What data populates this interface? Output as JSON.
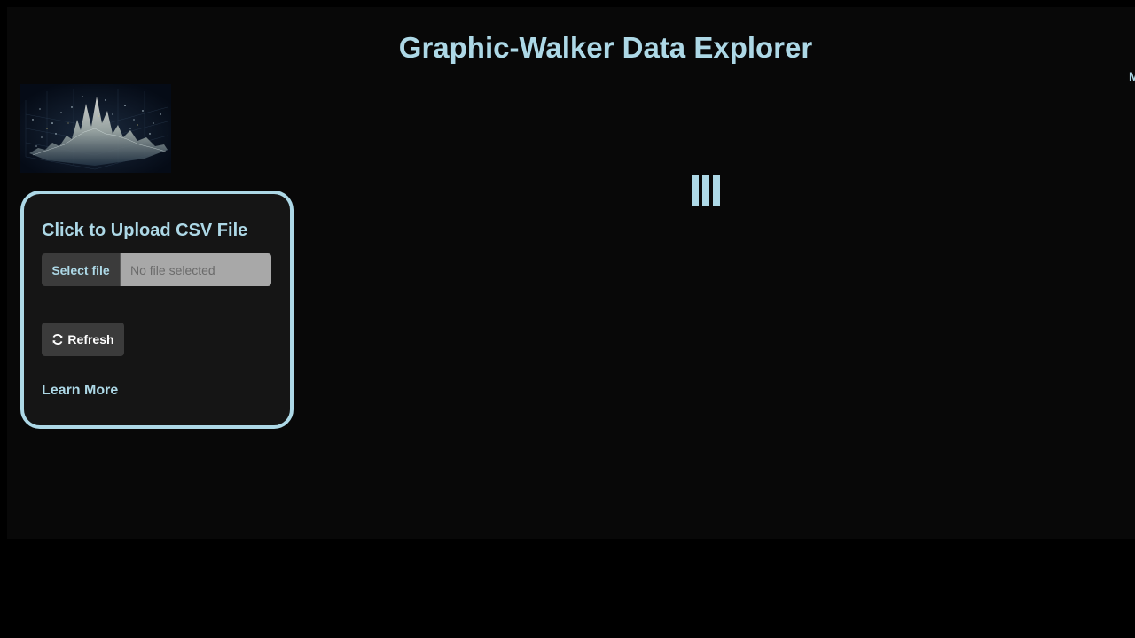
{
  "app": {
    "title": "Graphic-Walker Data Explorer",
    "edge_text": "M"
  },
  "sidebar": {
    "logo": {
      "icon": "data-landscape-image"
    },
    "upload": {
      "heading": "Click to Upload CSV File",
      "select_button_label": "Select file",
      "file_status": "No file selected"
    },
    "refresh_button": {
      "icon": "refresh-icon",
      "label": "Refresh"
    },
    "learn_more_link": "Learn More"
  },
  "main": {
    "loading_indicator": {
      "icon": "loading-bars-icon"
    }
  },
  "colors": {
    "accent": "#add8e6",
    "page_background": "#000000",
    "frame_background": "#080808",
    "panel_background": "#151515",
    "button_background": "#3b3b3b"
  }
}
